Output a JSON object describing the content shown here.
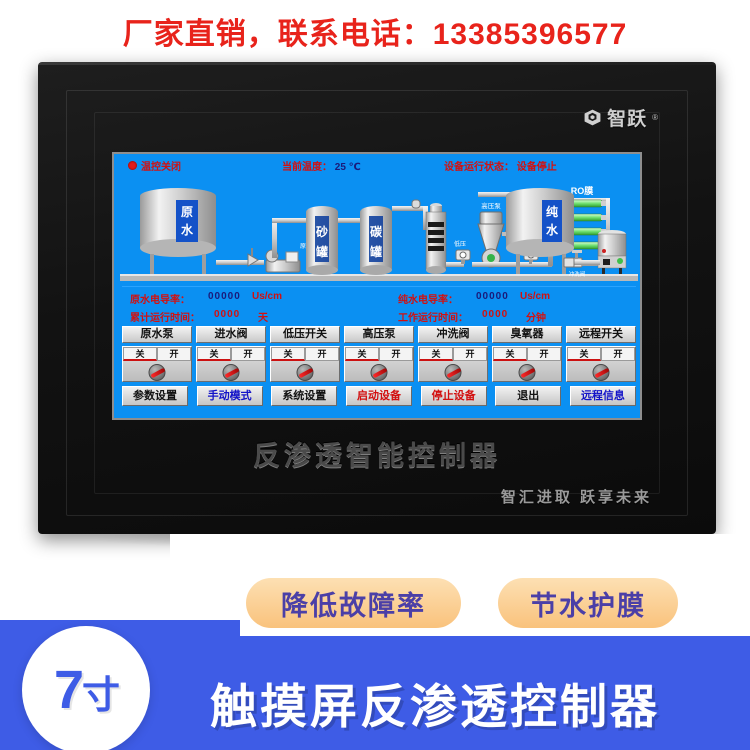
{
  "banner": {
    "text": "厂家直销，联系电话：13385396577",
    "color": "#e8231b"
  },
  "device": {
    "logo_name": "智跃",
    "logo_mark": "registered-trademark",
    "bezel_title": "反渗透智能控制器",
    "bezel_slogan": "智汇进取  跃享未来"
  },
  "screen": {
    "header": {
      "alarm_label": "温控关闭",
      "temp_label": "当前温度：",
      "temp_value": "25 ℃",
      "state_label": "设备运行状态：",
      "state_value": "设备停止"
    },
    "diagram": {
      "raw_tank_label": "原水",
      "pure_tank_label": "纯水",
      "sand_tank_label": "砂罐",
      "carbon_tank_label": "碳罐",
      "raw_pump_label": "原水泵",
      "high_pump_label": "高压泵",
      "low_press_label": "低压",
      "high_press_label": "高压",
      "ro_label": "RO膜",
      "flush_valve_label": "冲洗阀"
    },
    "readout": {
      "raw_cond_label": "原水电导率：",
      "raw_cond_value": "00000",
      "raw_cond_unit": "Us/cm",
      "pure_cond_label": "纯水电导率：",
      "pure_cond_value": "00000",
      "pure_cond_unit": "Us/cm",
      "total_time_label": "累计运行时间：",
      "total_time_value": "0000",
      "total_time_unit": "天",
      "work_time_label": "工作运行时间：",
      "work_time_value": "0000",
      "work_time_unit": "分钟"
    },
    "devices": [
      {
        "title": "原水泵",
        "off": "关",
        "on": "开",
        "active": "off"
      },
      {
        "title": "进水阀",
        "off": "关",
        "on": "开",
        "active": "off"
      },
      {
        "title": "低压开关",
        "off": "关",
        "on": "开",
        "active": "off"
      },
      {
        "title": "高压泵",
        "off": "关",
        "on": "开",
        "active": "off"
      },
      {
        "title": "冲洗阀",
        "off": "关",
        "on": "开",
        "active": "off"
      },
      {
        "title": "臭氧器",
        "off": "关",
        "on": "开",
        "active": "off"
      },
      {
        "title": "远程开关",
        "off": "关",
        "on": "开",
        "active": "off"
      }
    ],
    "menu": [
      {
        "label": "参数设置",
        "style": "black"
      },
      {
        "label": "手动模式",
        "style": "blue"
      },
      {
        "label": "系统设置",
        "style": "black"
      },
      {
        "label": "启动设备",
        "style": "red"
      },
      {
        "label": "停止设备",
        "style": "red"
      },
      {
        "label": "退出",
        "style": "black"
      },
      {
        "label": "远程信息",
        "style": "blue"
      }
    ]
  },
  "marketing": {
    "pill_1": "降低故障率",
    "pill_2": "节水护膜",
    "size_badge_number": "7",
    "size_badge_unit": "寸",
    "bottom_title": "触摸屏反渗透控制器",
    "accent_blue": "#3e5ce6",
    "accent_orange": "#f9c27c",
    "accent_purple": "#4b3fa7"
  }
}
